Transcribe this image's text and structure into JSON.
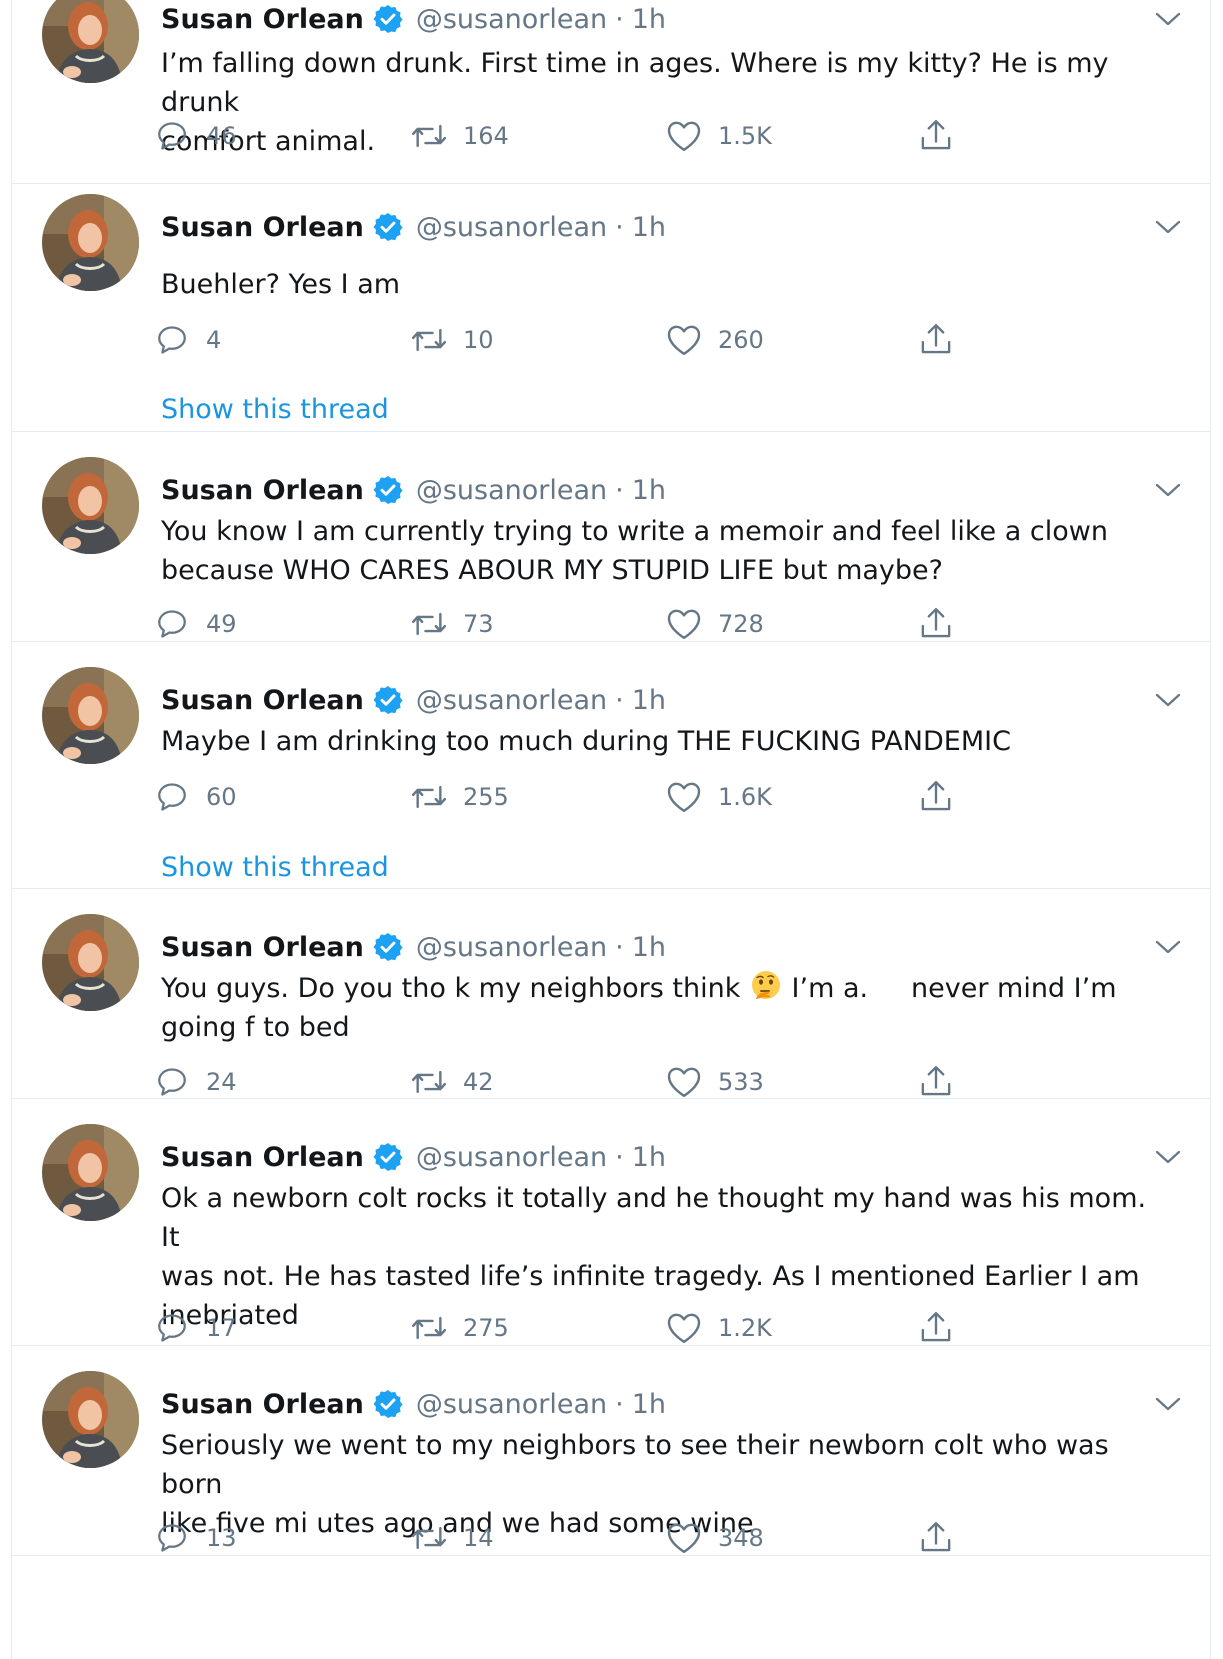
{
  "tweets": [
    {
      "author": {
        "name": "Susan Orlean",
        "handle": "@susanorlean",
        "verified": true
      },
      "time": "1h",
      "text": "I’m falling down drunk. First time in ages. Where is my kitty? He is my drunk\ncomfort animal.",
      "stats": {
        "replies": "46",
        "retweets": "164",
        "likes": "1.5K"
      },
      "show_thread": ""
    },
    {
      "author": {
        "name": "Susan Orlean",
        "handle": "@susanorlean",
        "verified": true
      },
      "time": "1h",
      "text": "Buehler? Yes I am",
      "stats": {
        "replies": "4",
        "retweets": "10",
        "likes": "260"
      },
      "show_thread": "Show this thread"
    },
    {
      "author": {
        "name": "Susan Orlean",
        "handle": "@susanorlean",
        "verified": true
      },
      "time": "1h",
      "text": "You know I am currently trying to write a memoir and feel like a clown\nbecause WHO CARES ABOUR MY STUPID LIFE but maybe?",
      "stats": {
        "replies": "49",
        "retweets": "73",
        "likes": "728"
      },
      "show_thread": ""
    },
    {
      "author": {
        "name": "Susan Orlean",
        "handle": "@susanorlean",
        "verified": true
      },
      "time": "1h",
      "text": "Maybe I am drinking too much during THE FUCKING PANDEMIC",
      "stats": {
        "replies": "60",
        "retweets": "255",
        "likes": "1.6K"
      },
      "show_thread": "Show this thread"
    },
    {
      "author": {
        "name": "Susan Orlean",
        "handle": "@susanorlean",
        "verified": true
      },
      "time": "1h",
      "text_before_emoji": "You guys. Do you tho k my neighbors think ",
      "emoji": "thinking-face-emoji",
      "text_after_emoji": " I’m a.     never mind I’m\ngoing f to bed",
      "stats": {
        "replies": "24",
        "retweets": "42",
        "likes": "533"
      },
      "show_thread": ""
    },
    {
      "author": {
        "name": "Susan Orlean",
        "handle": "@susanorlean",
        "verified": true
      },
      "time": "1h",
      "text": "Ok a newborn colt rocks it totally and he thought my hand was his mom. It\nwas not. He has tasted life’s infinite tragedy. As I mentioned Earlier I am\ninebriated",
      "stats": {
        "replies": "17",
        "retweets": "275",
        "likes": "1.2K"
      },
      "show_thread": ""
    },
    {
      "author": {
        "name": "Susan Orlean",
        "handle": "@susanorlean",
        "verified": true
      },
      "time": "1h",
      "text": "Seriously we went to my neighbors to see their newborn colt who was born\nlike five mi utes ago and we had some wine",
      "stats": {
        "replies": "13",
        "retweets": "14",
        "likes": "348"
      },
      "show_thread": ""
    }
  ],
  "colors": {
    "accent": "#1b95e0",
    "verified": "#1da1f2",
    "muted": "#657786",
    "text": "#14171a",
    "border": "#e6ecf0"
  },
  "icons": {
    "reply": "reply-icon",
    "retweet": "retweet-icon",
    "like": "like-icon",
    "share": "share-icon",
    "menu": "chevron-down-icon",
    "verified": "verified-badge-icon"
  },
  "separator": "·"
}
